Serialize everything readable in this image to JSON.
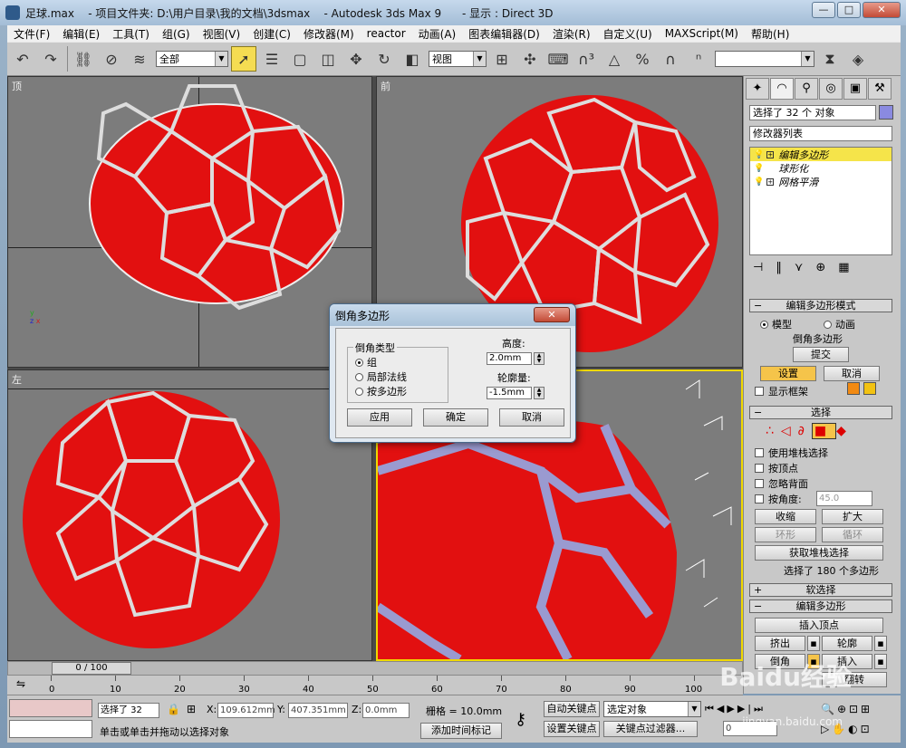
{
  "window": {
    "title": "足球.max    - 项目文件夹: D:\\用户目录\\我的文档\\3dsmax    - Autodesk 3ds Max 9      - 显示 : Direct 3D",
    "min": "—",
    "max": "□",
    "close": "✕"
  },
  "menu": [
    "文件(F)",
    "编辑(E)",
    "工具(T)",
    "组(G)",
    "视图(V)",
    "创建(C)",
    "修改器(M)",
    "reactor",
    "动画(A)",
    "图表编辑器(D)",
    "渲染(R)",
    "自定义(U)",
    "MAXScript(M)",
    "帮助(H)"
  ],
  "toolbar": {
    "selection_filter": "全部",
    "ref_coord": "视图",
    "named_sel": ""
  },
  "viewports": {
    "top": "顶",
    "front": "前",
    "left": "左"
  },
  "dialog": {
    "title": "倒角多边形",
    "close": "✕",
    "group_label": "倒角类型",
    "radios": [
      "组",
      "局部法线",
      "按多边形"
    ],
    "height_label": "高度:",
    "height_value": "2.0mm",
    "outline_label": "轮廓量:",
    "outline_value": "-1.5mm",
    "apply": "应用",
    "ok": "确定",
    "cancel": "取消"
  },
  "command_panel": {
    "sel_field": "选择了 32 个 对象",
    "modifier_list": "修改器列表",
    "stack": [
      "编辑多边形",
      "球形化",
      "网格平滑"
    ],
    "rollout_edit_mode": "编辑多边形模式",
    "radio_model": "模型",
    "radio_anim": "动画",
    "current_op": "倒角多边形",
    "commit": "提交",
    "settings": "设置",
    "cancel": "取消",
    "show_cage": "显示框架",
    "rollout_select": "选择",
    "use_stack_sel": "使用堆栈选择",
    "by_vertex": "按顶点",
    "ignore_back": "忽略背面",
    "by_angle": "按角度:",
    "angle_value": "45.0",
    "shrink": "收缩",
    "grow": "扩大",
    "ring": "环形",
    "loop": "循环",
    "get_stack": "获取堆栈选择",
    "selected_info": "选择了 180 个多边形",
    "rollout_soft": "软选择",
    "rollout_edit_poly": "编辑多边形",
    "insert_vertex": "插入顶点",
    "extrude": "挤出",
    "outline": "轮廓",
    "bevel": "倒角",
    "inset": "插入",
    "flip": "翻转"
  },
  "timeline": {
    "frame": "0 / 100",
    "ticks": [
      "0",
      "10",
      "20",
      "30",
      "40",
      "50",
      "60",
      "70",
      "80",
      "90",
      "100"
    ]
  },
  "status": {
    "selected": "选择了 32",
    "x_label": "X:",
    "x_value": "109.612mm",
    "y_label": "Y:",
    "y_value": "407.351mm",
    "z_label": "Z:",
    "z_value": "0.0mm",
    "grid": "栅格 = 10.0mm",
    "prompt": "单击或单击并拖动以选择对象",
    "add_tag": "添加时间标记",
    "auto_key": "自动关键点",
    "set_key": "设置关键点",
    "key_filter": "关键点过滤器...",
    "sel_obj": "选定对象",
    "frame_value": "0"
  },
  "watermark": {
    "brand": "Baidu经验",
    "url": "jingyan.baidu.com"
  }
}
